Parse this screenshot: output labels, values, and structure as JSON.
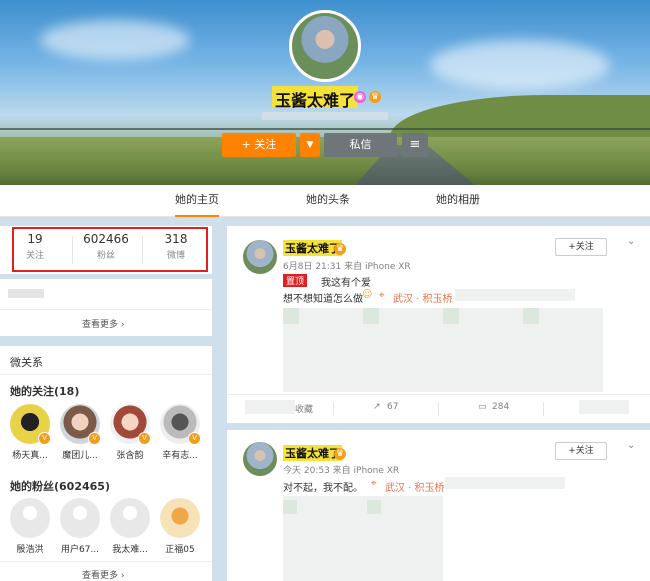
{
  "header": {
    "name": "玉酱太难了",
    "follow_label": "+ 关注",
    "message_label": "私信"
  },
  "tabs": [
    {
      "label": "她的主页",
      "active": true
    },
    {
      "label": "她的头条",
      "active": false
    },
    {
      "label": "她的相册",
      "active": false
    }
  ],
  "stats": [
    {
      "value": "19",
      "label": "关注"
    },
    {
      "value": "602466",
      "label": "粉丝"
    },
    {
      "value": "318",
      "label": "微博"
    }
  ],
  "info_card": {
    "more": "查看更多 ›"
  },
  "relations": {
    "title": "微关系",
    "following_title": "她的关注(18)",
    "following": [
      {
        "name": "杨天真..."
      },
      {
        "name": "魔团儿..."
      },
      {
        "name": "张含韵"
      },
      {
        "name": "辛有志..."
      }
    ],
    "fans_title": "她的粉丝(602465)",
    "fans": [
      {
        "name": "殷浩洪"
      },
      {
        "name": "用户67..."
      },
      {
        "name": "我太难..."
      },
      {
        "name": "正福05"
      }
    ],
    "more": "查看更多 ›"
  },
  "posts": [
    {
      "author": "玉酱太难了",
      "meta": "6月8日 21:31 来自 iPhone XR",
      "follow": "+关注",
      "tag": "置顶",
      "line1": "我这有个爱",
      "line2": "想不想知道怎么做",
      "location": "武汉 · 积玉桥",
      "forward": "67",
      "comment": "284",
      "favorite_label": "收藏"
    },
    {
      "author": "玉酱太难了",
      "meta": "今天 20:53 来自 iPhone XR",
      "follow": "+关注",
      "line1": "对不起，我不配。",
      "location": "武汉 · 积玉桥"
    }
  ],
  "colors": {
    "accent": "#ff8200",
    "highlight": "#f4e23a",
    "stat_box": "#e02020"
  }
}
